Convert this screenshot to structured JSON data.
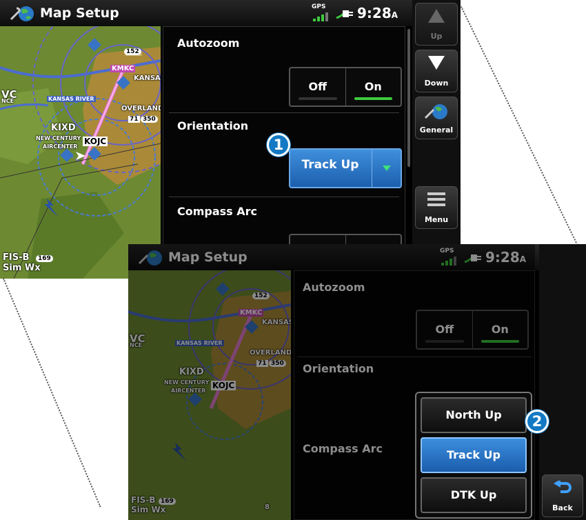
{
  "app_title": "Map Setup",
  "status": {
    "gps_label": "GPS",
    "clock": "9:28",
    "clock_suffix": "A"
  },
  "sections": {
    "autozoom": {
      "title": "Autozoom",
      "options": [
        "Off",
        "On"
      ],
      "selected": "On"
    },
    "orientation": {
      "title": "Orientation",
      "value": "Track Up"
    },
    "compass_arc": {
      "title": "Compass Arc"
    }
  },
  "sidebar": {
    "up": "Up",
    "down": "Down",
    "general": "General",
    "menu": "Menu",
    "back": "Back"
  },
  "popup": {
    "options": [
      "North Up",
      "Track Up",
      "DTK Up"
    ],
    "selected": "Track Up"
  },
  "callouts": {
    "first": "1",
    "second": "2"
  },
  "map": {
    "labels": {
      "kmkc": "KMKC",
      "kansas": "KANSAS",
      "kansas_river": "KANSAS RIVER",
      "overland": "OVERLAND",
      "kixd": "KIXD",
      "new_century": "NEW CENTURY",
      "aircenter": "AIRCENTER",
      "kojc": "KOJC",
      "vc": "VC",
      "nce": "NCE",
      "route_152": "152",
      "route_71": "71",
      "route_350": "350",
      "route_169": "169",
      "fisb": "FIS-B",
      "sim_wx": "Sim Wx",
      "scale": "8"
    }
  }
}
